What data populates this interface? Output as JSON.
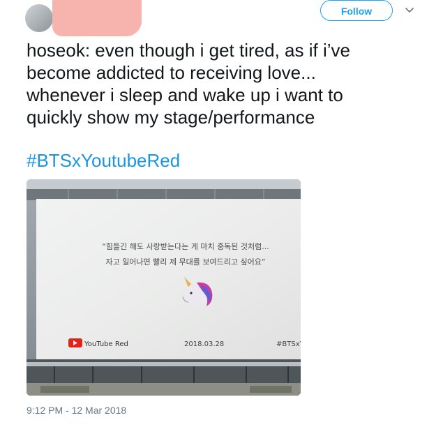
{
  "header": {
    "follow_label": "Follow",
    "follow_color": "#1da1f2",
    "menu_icon": "chevron-down-icon"
  },
  "tweet": {
    "lines": [
      "hoseok: even though i get tired, as if i’ve",
      "become addicted to receiving love...",
      "whenever i sleep and wake up i want to",
      "quickly show my stage/performance"
    ],
    "hashtag": "#BTSxYoutubeRed",
    "hashtag_color": "#1b95e0",
    "timestamp": "9:12 PM - 12 Mar 2018"
  },
  "media": {
    "quote_line1": "“힘들긴 해도 사랑받는다는 게 마치 중독된 것처럼...",
    "quote_line2": "자고 일어나면 빨리 제 무대를 보여드리고 싶어요”",
    "brand": "YouTube Red",
    "date": "2018.03.28",
    "tag": "#BTSxY",
    "unicorn_icon": "unicorn-icon"
  }
}
